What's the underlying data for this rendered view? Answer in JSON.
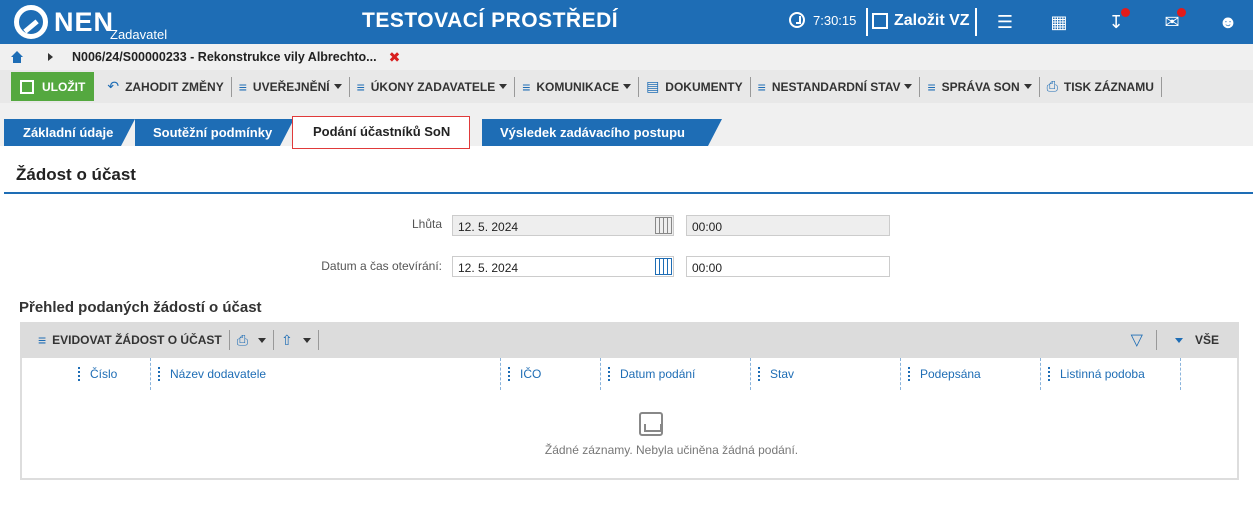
{
  "topbar": {
    "logo_text": "NEN",
    "logo_subtitle": "Zadavatel",
    "environment_title": "TESTOVACÍ PROSTŘEDÍ",
    "time": "7:30:15",
    "create_label": "Založit VZ",
    "icons": [
      "menu-icon",
      "calculator-icon",
      "download-icon",
      "mail-icon",
      "user-icon"
    ]
  },
  "breadcrumb": {
    "path": "N006/24/S00000233 - Rekonstrukce vily Albrechto...",
    "close": "✖"
  },
  "toolbar": {
    "save": "ULOŽIT",
    "discard": "ZAHODIT ZMĚNY",
    "publishing": "UVEŘEJNĚNÍ",
    "acts": "ÚKONY ZADAVATELE",
    "communication": "KOMUNIKACE",
    "documents": "DOKUMENTY",
    "nonstandard": "NESTANDARDNÍ STAV",
    "son_admin": "SPRÁVA SON",
    "print": "TISK ZÁZNAMU"
  },
  "tabs": [
    {
      "label": "Základní údaje"
    },
    {
      "label": "Soutěžní podmínky"
    },
    {
      "label": "Podání účastníků SoN",
      "active": true
    },
    {
      "label": "Výsledek zadávacího postupu"
    }
  ],
  "section": {
    "title": "Žádost o účast",
    "deadline_label": "Lhůta",
    "deadline_date": "12. 5. 2024",
    "deadline_time": "00:00",
    "opening_label": "Datum a čas otevírání:",
    "opening_date": "12. 5. 2024",
    "opening_time": "00:00"
  },
  "grid": {
    "title": "Přehled podaných žádostí o účast",
    "add_label": "EVIDOVAT ŽÁDOST O ÚČAST",
    "all_label": "VŠE",
    "columns": [
      "Číslo",
      "Název dodavatele",
      "IČO",
      "Datum podání",
      "Stav",
      "Podepsána",
      "Listinná podoba"
    ],
    "empty_text": "Žádné záznamy. Nebyla učiněna žádná podání."
  },
  "colors": {
    "primary": "#1e6db5",
    "save_green": "#54a83f",
    "badge_red": "#e21b1b"
  }
}
